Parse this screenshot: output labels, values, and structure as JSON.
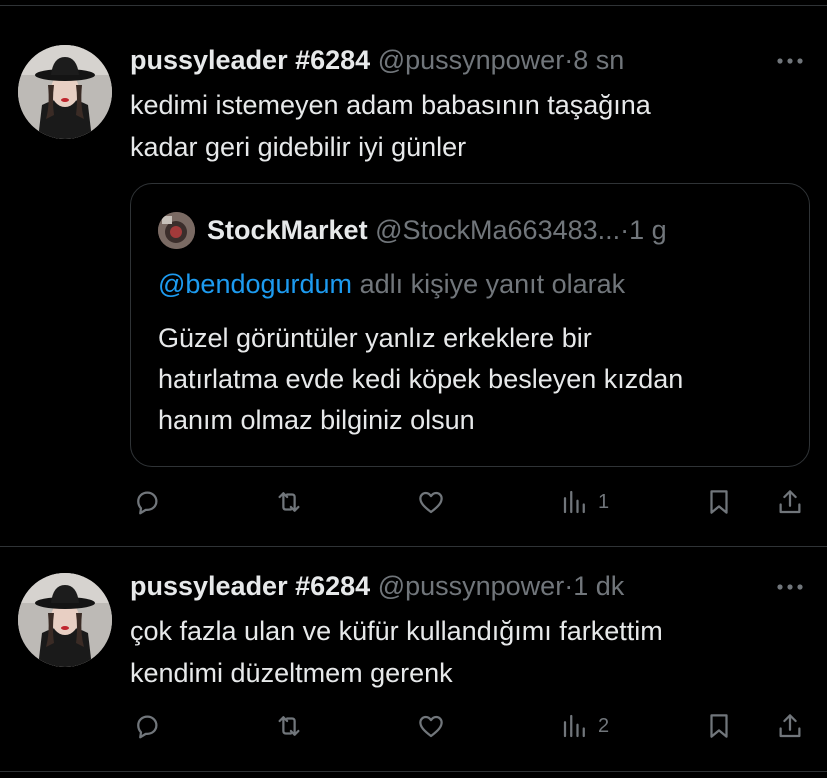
{
  "colors": {
    "background": "#000000",
    "text_primary": "#e7e9ea",
    "text_secondary": "#71767b",
    "link": "#1d9bf0",
    "divider": "#2f3336"
  },
  "tweets": [
    {
      "display_name": "pussyleader #6284",
      "handle": "@pussynpower",
      "separator": "·",
      "time": "8 sn",
      "text_lines": [
        "kedimi istemeyen adam babasının taşağına",
        "kadar geri gidebilir iyi günler"
      ],
      "quote": {
        "display_name": "StockMarket",
        "handle": "@StockMa663483...",
        "separator": "·",
        "time": "1 g",
        "reply_mention": "@bendogurdum",
        "reply_suffix": "adlı kişiye yanıt olarak",
        "text_lines": [
          "Güzel görüntüler yanlız erkeklere bir",
          "hatırlatma evde kedi köpek besleyen kızdan",
          "hanım olmaz bilginiz olsun"
        ]
      },
      "actions": {
        "reply_icon": "reply-icon",
        "retweet_icon": "retweet-icon",
        "like_icon": "heart-icon",
        "views_icon": "views-icon",
        "views_count": "1",
        "bookmark_icon": "bookmark-icon",
        "share_icon": "share-icon"
      }
    },
    {
      "display_name": "pussyleader #6284",
      "handle": "@pussynpower",
      "separator": "·",
      "time": "1 dk",
      "text_lines": [
        "çok fazla ulan ve küfür kullandığımı farkettim",
        "kendimi düzeltmem gerenk"
      ],
      "actions": {
        "reply_icon": "reply-icon",
        "retweet_icon": "retweet-icon",
        "like_icon": "heart-icon",
        "views_icon": "views-icon",
        "views_count": "2",
        "bookmark_icon": "bookmark-icon",
        "share_icon": "share-icon"
      }
    }
  ]
}
